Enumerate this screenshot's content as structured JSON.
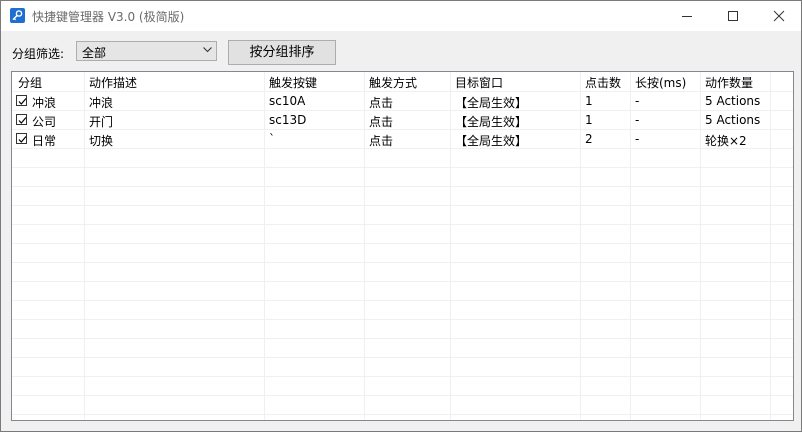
{
  "window": {
    "title": "快捷键管理器 V3.0 (极简版)"
  },
  "toolbar": {
    "filter_label": "分组筛选:",
    "filter_value": "全部",
    "sort_button_label": "按分组排序"
  },
  "table": {
    "columns": [
      "分组",
      "动作描述",
      "触发按键",
      "触发方式",
      "目标窗口",
      "点击数",
      "长按(ms)",
      "动作数量"
    ],
    "rows": [
      {
        "checked": true,
        "group": "冲浪",
        "description": "冲浪",
        "key": "sc10A",
        "method": "点击",
        "target": "【全局生效】",
        "clicks": "1",
        "hold": "-",
        "actions": "5 Actions"
      },
      {
        "checked": true,
        "group": "公司",
        "description": "开门",
        "key": "sc13D",
        "method": "点击",
        "target": "【全局生效】",
        "clicks": "1",
        "hold": "-",
        "actions": "5 Actions"
      },
      {
        "checked": true,
        "group": "日常",
        "description": "切换",
        "key": "`",
        "method": "点击",
        "target": "【全局生效】",
        "clicks": "2",
        "hold": "-",
        "actions": "轮换×2"
      }
    ]
  },
  "icons": {
    "app": "key-icon",
    "minimize": "minimize-icon",
    "maximize": "maximize-icon",
    "close": "close-icon",
    "dropdown": "chevron-down-icon",
    "checkbox": "checkmark-icon"
  },
  "colors": {
    "app_icon": "#1f6fd1",
    "grid_line": "#f0f0f0"
  }
}
